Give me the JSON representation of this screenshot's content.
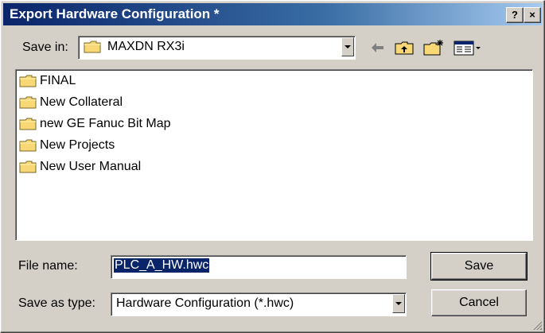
{
  "window": {
    "title": "Export Hardware Configuration *",
    "help_label": "?",
    "close_label": "×"
  },
  "toolbar": {
    "save_in_label": "Save in:",
    "save_in_value": "MAXDN RX3i",
    "back_icon": "back-arrow-icon",
    "up_icon": "up-folder-icon",
    "new_folder_icon": "new-folder-icon",
    "view_icon": "view-menu-icon"
  },
  "file_list": {
    "items": [
      {
        "label": "FINAL",
        "icon": "folder-icon"
      },
      {
        "label": "New Collateral",
        "icon": "folder-icon"
      },
      {
        "label": "new GE Fanuc Bit Map",
        "icon": "folder-icon"
      },
      {
        "label": "New Projects",
        "icon": "folder-icon"
      },
      {
        "label": "New User Manual",
        "icon": "folder-icon"
      }
    ]
  },
  "form": {
    "file_name_label": "File name:",
    "file_name_value": "PLC_A_HW.hwc",
    "save_as_type_label": "Save as type:",
    "save_as_type_value": "Hardware Configuration (*.hwc)"
  },
  "buttons": {
    "save": "Save",
    "cancel": "Cancel"
  },
  "colors": {
    "title_bar": "#0a246a",
    "dialog_face": "#d4d0c8",
    "selection": "#0a246a",
    "folder_yellow": "#f8d775"
  }
}
